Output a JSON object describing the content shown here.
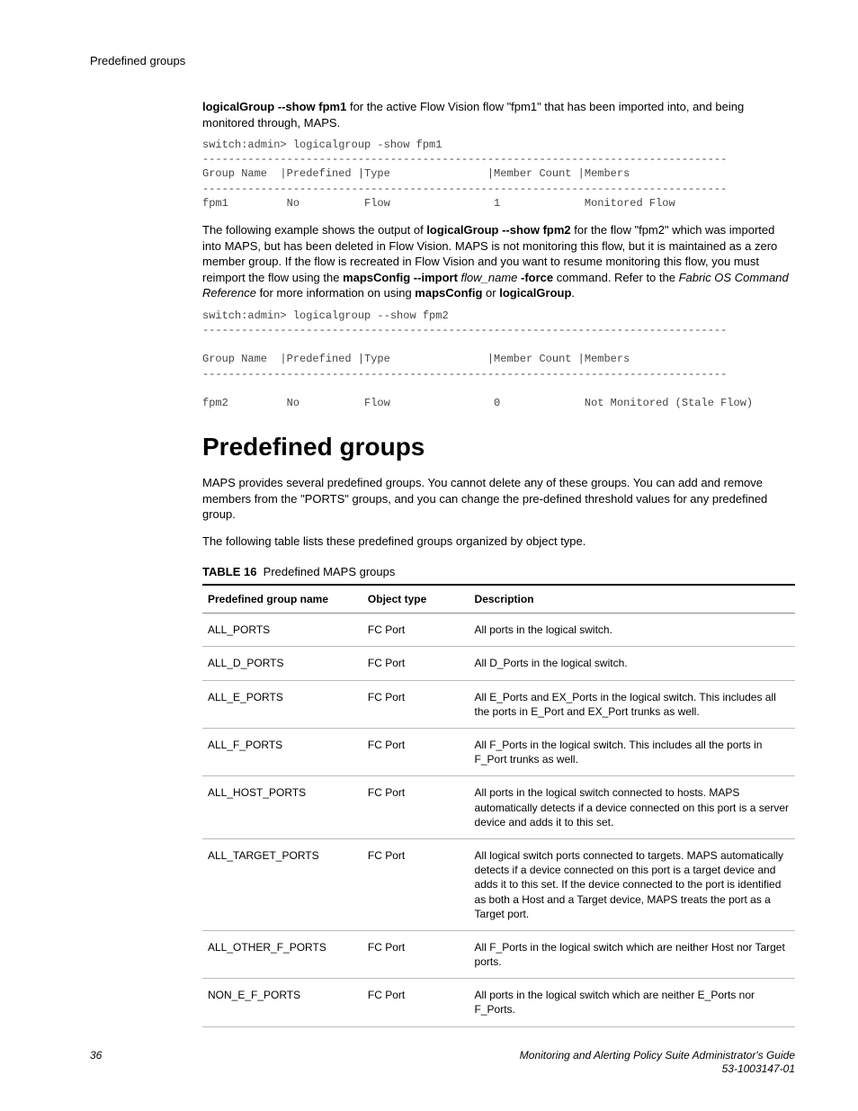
{
  "header": {
    "label": "Predefined groups"
  },
  "intro1": {
    "bold_lead": "logicalGroup --show fpm1",
    "text_after": " for the active Flow Vision flow \"fpm1\" that has been imported into, and being monitored through, MAPS."
  },
  "code1": "switch:admin> logicalgroup -show fpm1\n---------------------------------------------------------------------------------\nGroup Name  |Predefined |Type               |Member Count |Members                \n---------------------------------------------------------------------------------\nfpm1         No          Flow                1             Monitored Flow",
  "para2": {
    "p1a": "The following example shows the output of ",
    "p1b_bold": "logicalGroup --show fpm2",
    "p1c": " for the flow \"fpm2\" which was imported into MAPS, but has been deleted in Flow Vision. MAPS is not monitoring this flow, but it is maintained as a zero member group. If the flow is recreated in Flow Vision and you want to resume monitoring this flow, you must reimport the flow using the ",
    "p1d_bold": "mapsConfig --import",
    "p1e_italic": " flow_name ",
    "p1f_bold": "-force",
    "p1g": " command. Refer to the ",
    "p1h_italic": "Fabric OS Command Reference",
    "p1i": " for more information on using ",
    "p1j_bold": "mapsConfig",
    "p1k": " or ",
    "p1l_bold": "logicalGroup",
    "p1m": "."
  },
  "code2": "switch:admin> logicalgroup --show fpm2\n---------------------------------------------------------------------------------\n\nGroup Name  |Predefined |Type               |Member Count |Members                \n---------------------------------------------------------------------------------\n\nfpm2         No          Flow                0             Not Monitored (Stale Flow)",
  "section_title": "Predefined groups",
  "section_para1": "MAPS provides several predefined groups. You cannot delete any of these groups. You can add and remove members from the \"PORTS\" groups, and you can change the pre-defined threshold values for any predefined group.",
  "section_para2": "The following table lists these predefined groups organized by object type.",
  "table_caption": {
    "label": "TABLE 16",
    "title": "Predefined MAPS groups"
  },
  "table_headers": {
    "c1": "Predefined group name",
    "c2": "Object type",
    "c3": "Description"
  },
  "rows": [
    {
      "name": "ALL_PORTS",
      "type": "FC Port",
      "desc": "All ports in the logical switch."
    },
    {
      "name": "ALL_D_PORTS",
      "type": "FC Port",
      "desc": "All D_Ports in the logical switch."
    },
    {
      "name": "ALL_E_PORTS",
      "type": "FC Port",
      "desc": "All E_Ports and EX_Ports in the logical switch. This includes all the ports in E_Port and EX_Port trunks as well."
    },
    {
      "name": "ALL_F_PORTS",
      "type": "FC Port",
      "desc": "All F_Ports in the logical switch. This includes all the ports in F_Port trunks as well."
    },
    {
      "name": "ALL_HOST_PORTS",
      "type": "FC Port",
      "desc": "All ports in the logical switch connected to hosts. MAPS automatically detects if a device connected on this port is a server device and adds it to this set."
    },
    {
      "name": "ALL_TARGET_PORTS",
      "type": "FC Port",
      "desc": "All logical switch ports connected to targets. MAPS automatically detects if a device connected on this port is a target device and adds it to this set. If the device connected to the port is identified as both a Host and a Target device, MAPS treats the port as a Target port."
    },
    {
      "name": "ALL_OTHER_F_PORTS",
      "type": "FC Port",
      "desc": "All F_Ports in the logical switch which are neither Host nor Target ports."
    },
    {
      "name": "NON_E_F_PORTS",
      "type": "FC Port",
      "desc": "All ports in the logical switch which are neither E_Ports nor F_Ports."
    }
  ],
  "footer": {
    "page": "36",
    "guide_title": "Monitoring and Alerting Policy Suite Administrator's Guide",
    "doc_id": "53-1003147-01"
  }
}
